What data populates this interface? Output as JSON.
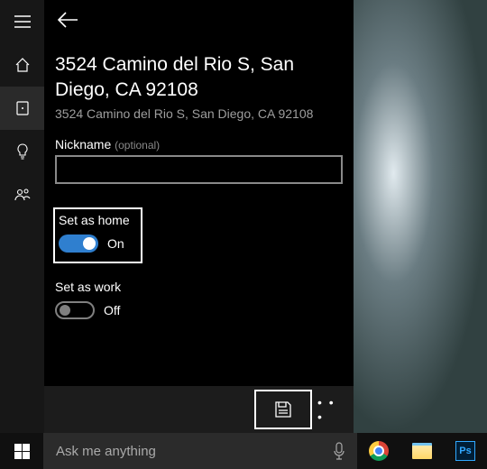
{
  "panel": {
    "title": "3524 Camino del Rio S, San Diego, CA 92108",
    "subtitle": "3524 Camino del Rio S, San Diego, CA 92108",
    "nickname_label": "Nickname ",
    "nickname_optional": "(optional)",
    "nickname_value": "",
    "home_toggle": {
      "label": "Set as home",
      "state_text": "On",
      "on": true
    },
    "work_toggle": {
      "label": "Set as work",
      "state_text": "Off",
      "on": false
    }
  },
  "bottom": {
    "more": "• • •"
  },
  "taskbar": {
    "search_placeholder": "Ask me anything",
    "ps_label": "Ps"
  }
}
